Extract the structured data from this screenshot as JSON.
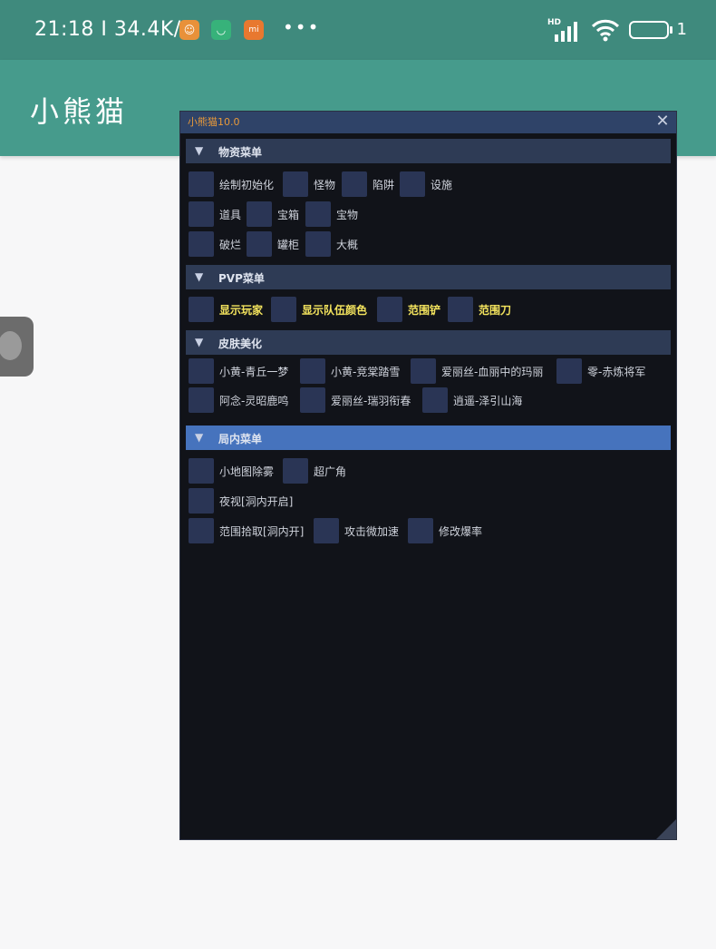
{
  "status_bar": {
    "time": "21:18",
    "speed": "34.4K/s",
    "network_label": "HD",
    "battery": "1",
    "icons": [
      "app-icon-orange",
      "app-icon-green",
      "mi-icon"
    ]
  },
  "app_bar": {
    "title": "小熊猫"
  },
  "window": {
    "title": "小熊猫10.0",
    "sections": [
      {
        "label": "物资菜单",
        "rows": [
          [
            "绘制初始化",
            "怪物",
            "陷阱",
            "设施"
          ],
          [
            "道具",
            "宝箱",
            "宝物"
          ],
          [
            "破烂",
            "罐柜",
            "大概"
          ]
        ]
      },
      {
        "label": "PVP菜单",
        "rows": [
          [
            "显示玩家",
            "显示队伍颜色",
            "范围铲",
            "范围刀"
          ]
        ]
      },
      {
        "label": "皮肤美化",
        "rows": [
          [
            "小黄-青丘一梦",
            "小黄-竞棠踏雪",
            "爱丽丝-血丽中的玛丽",
            "零-赤炼将军"
          ],
          [
            "阿念-灵昭鹿鸣",
            "爱丽丝-瑞羽衔春",
            "逍遥-泽引山海"
          ]
        ]
      },
      {
        "label": "局内菜单",
        "rows": [
          [
            "小地图除雾",
            "超广角"
          ],
          [
            "夜视[洞内开启]"
          ],
          [
            "范围拾取[洞内开]",
            "攻击微加速",
            "修改爆率"
          ]
        ]
      }
    ]
  },
  "colors": {
    "status_bar": "#3f8a7d",
    "app_bar": "#469b8c",
    "window_bg": "#111319",
    "section_bg": "#2e3b55",
    "section_active": "#4673bd",
    "checkbox": "#2a3555",
    "pvp_text": "#f3e35d"
  }
}
